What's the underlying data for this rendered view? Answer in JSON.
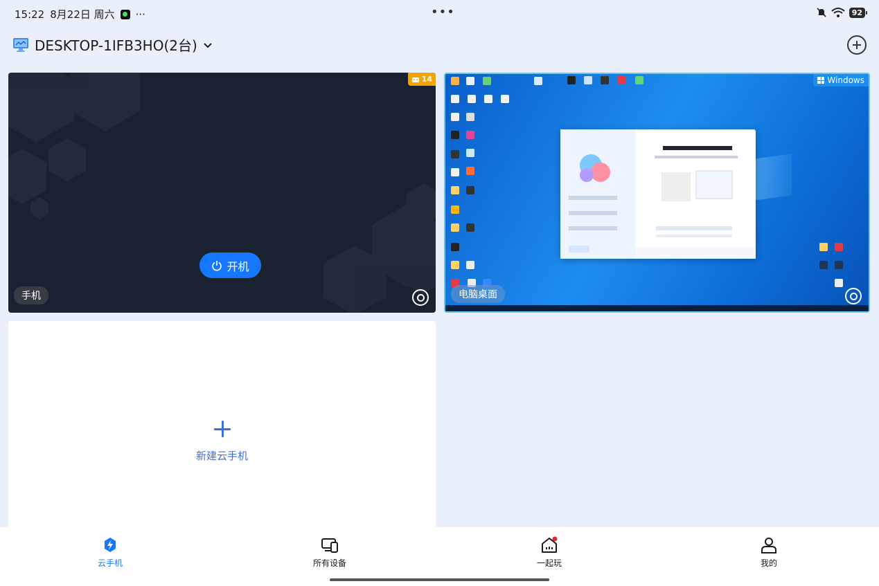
{
  "status_bar": {
    "time": "15:22",
    "date": "8月22日 周六",
    "overflow": "···",
    "center_dots": "•••",
    "battery": "92"
  },
  "header": {
    "device_title": "DESKTOP-1IFB3HO(2台)",
    "add_button_icon": "plus-circle-icon"
  },
  "cards": {
    "phone": {
      "badge_count": "14",
      "power_button_label": "开机",
      "label": "手机"
    },
    "pc": {
      "badge_label": "Windows",
      "label": "电脑桌面"
    },
    "new_phone": {
      "label": "新建云手机"
    }
  },
  "bottom_nav": {
    "items": [
      {
        "label": "云手机",
        "icon": "cloud-phone-icon",
        "active": true
      },
      {
        "label": "所有设备",
        "icon": "devices-icon",
        "active": false
      },
      {
        "label": "一起玩",
        "icon": "home-icon",
        "active": false
      },
      {
        "label": "我的",
        "icon": "user-icon",
        "active": false
      }
    ]
  },
  "colors": {
    "accent": "#1677ff",
    "badge_orange": "#f5a300",
    "background": "#e9f0fb"
  }
}
